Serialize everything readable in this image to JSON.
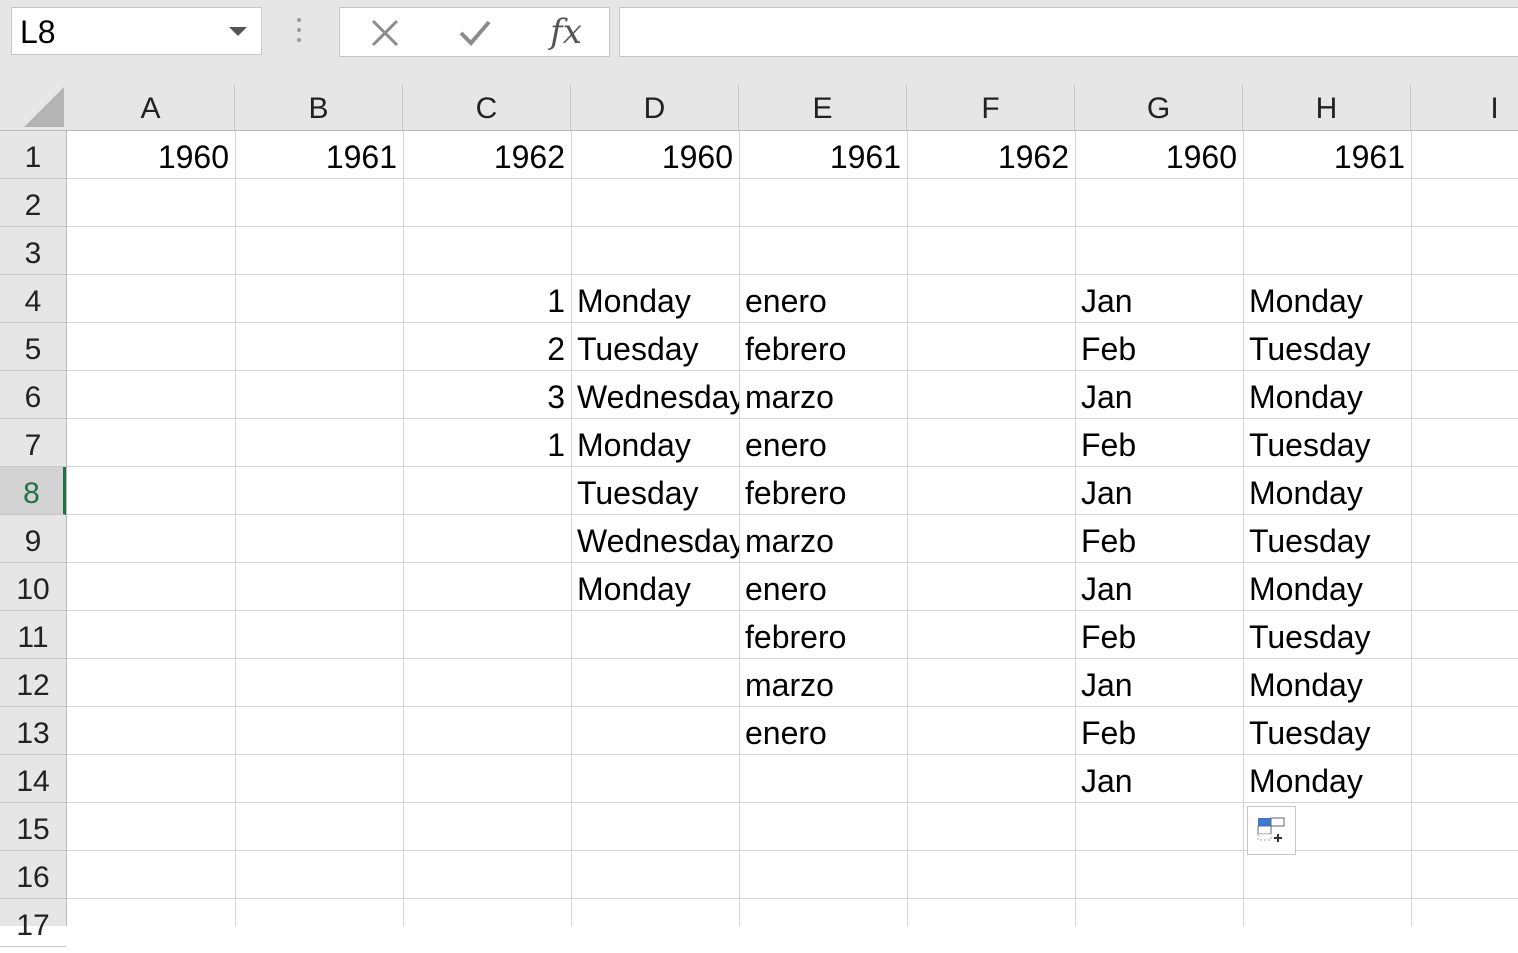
{
  "name_box": {
    "value": "L8"
  },
  "formula_bar": {
    "value": "",
    "fx_label": "fx"
  },
  "columns": [
    "A",
    "B",
    "C",
    "D",
    "E",
    "F",
    "G",
    "H",
    "I"
  ],
  "rows": [
    "1",
    "2",
    "3",
    "4",
    "5",
    "6",
    "7",
    "8",
    "9",
    "10",
    "11",
    "12",
    "13",
    "14",
    "15",
    "16",
    "17"
  ],
  "active_row": "8",
  "cells": [
    {
      "ref": "A1",
      "value": "1960",
      "type": "num"
    },
    {
      "ref": "B1",
      "value": "1961",
      "type": "num"
    },
    {
      "ref": "C1",
      "value": "1962",
      "type": "num"
    },
    {
      "ref": "D1",
      "value": "1960",
      "type": "num"
    },
    {
      "ref": "E1",
      "value": "1961",
      "type": "num"
    },
    {
      "ref": "F1",
      "value": "1962",
      "type": "num"
    },
    {
      "ref": "G1",
      "value": "1960",
      "type": "num"
    },
    {
      "ref": "H1",
      "value": "1961",
      "type": "num"
    },
    {
      "ref": "C4",
      "value": "1",
      "type": "num"
    },
    {
      "ref": "C5",
      "value": "2",
      "type": "num"
    },
    {
      "ref": "C6",
      "value": "3",
      "type": "num"
    },
    {
      "ref": "C7",
      "value": "1",
      "type": "num"
    },
    {
      "ref": "D4",
      "value": "Monday",
      "type": "txt"
    },
    {
      "ref": "D5",
      "value": "Tuesday",
      "type": "txt"
    },
    {
      "ref": "D6",
      "value": "Wednesday",
      "type": "txt"
    },
    {
      "ref": "D7",
      "value": "Monday",
      "type": "txt"
    },
    {
      "ref": "D8",
      "value": "Tuesday",
      "type": "txt"
    },
    {
      "ref": "D9",
      "value": "Wednesday",
      "type": "txt"
    },
    {
      "ref": "D10",
      "value": "Monday",
      "type": "txt"
    },
    {
      "ref": "E4",
      "value": "enero",
      "type": "txt"
    },
    {
      "ref": "E5",
      "value": "febrero",
      "type": "txt"
    },
    {
      "ref": "E6",
      "value": "marzo",
      "type": "txt"
    },
    {
      "ref": "E7",
      "value": "enero",
      "type": "txt"
    },
    {
      "ref": "E8",
      "value": "febrero",
      "type": "txt"
    },
    {
      "ref": "E9",
      "value": "marzo",
      "type": "txt"
    },
    {
      "ref": "E10",
      "value": "enero",
      "type": "txt"
    },
    {
      "ref": "E11",
      "value": "febrero",
      "type": "txt"
    },
    {
      "ref": "E12",
      "value": "marzo",
      "type": "txt"
    },
    {
      "ref": "E13",
      "value": "enero",
      "type": "txt"
    },
    {
      "ref": "G4",
      "value": "Jan",
      "type": "txt"
    },
    {
      "ref": "G5",
      "value": "Feb",
      "type": "txt"
    },
    {
      "ref": "G6",
      "value": "Jan",
      "type": "txt"
    },
    {
      "ref": "G7",
      "value": "Feb",
      "type": "txt"
    },
    {
      "ref": "G8",
      "value": "Jan",
      "type": "txt"
    },
    {
      "ref": "G9",
      "value": "Feb",
      "type": "txt"
    },
    {
      "ref": "G10",
      "value": "Jan",
      "type": "txt"
    },
    {
      "ref": "G11",
      "value": "Feb",
      "type": "txt"
    },
    {
      "ref": "G12",
      "value": "Jan",
      "type": "txt"
    },
    {
      "ref": "G13",
      "value": "Feb",
      "type": "txt"
    },
    {
      "ref": "G14",
      "value": "Jan",
      "type": "txt"
    },
    {
      "ref": "H4",
      "value": "Monday",
      "type": "txt"
    },
    {
      "ref": "H5",
      "value": "Tuesday",
      "type": "txt"
    },
    {
      "ref": "H6",
      "value": "Monday",
      "type": "txt"
    },
    {
      "ref": "H7",
      "value": "Tuesday",
      "type": "txt"
    },
    {
      "ref": "H8",
      "value": "Monday",
      "type": "txt"
    },
    {
      "ref": "H9",
      "value": "Tuesday",
      "type": "txt"
    },
    {
      "ref": "H10",
      "value": "Monday",
      "type": "txt"
    },
    {
      "ref": "H11",
      "value": "Tuesday",
      "type": "txt"
    },
    {
      "ref": "H12",
      "value": "Monday",
      "type": "txt"
    },
    {
      "ref": "H13",
      "value": "Tuesday",
      "type": "txt"
    },
    {
      "ref": "H14",
      "value": "Monday",
      "type": "txt"
    }
  ],
  "colors": {
    "header_bg": "#e6e6e6",
    "active_accent": "#217346",
    "gridline": "#d4d4d4"
  }
}
